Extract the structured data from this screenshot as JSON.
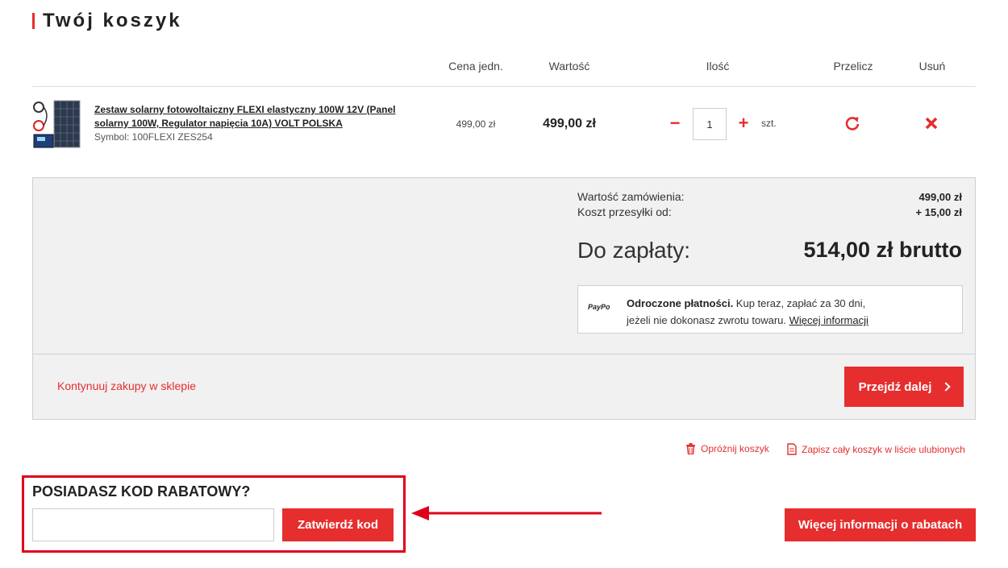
{
  "page": {
    "title": "Twój koszyk"
  },
  "table": {
    "headers": {
      "unit_price": "Cena jedn.",
      "value": "Wartość",
      "quantity": "Ilość",
      "recalc": "Przelicz",
      "remove": "Usuń"
    },
    "item": {
      "name": "Zestaw solarny fotowoltaiczny FLEXI elastyczny 100W 12V (Panel solarny 100W, Regulator napięcia 10A) VOLT POLSKA",
      "symbol": "Symbol: 100FLEXI ZES254",
      "unit_price": "499,00 zł",
      "value": "499,00 zł",
      "quantity": "1",
      "unit": "szt.",
      "minus": "−",
      "plus": "+"
    }
  },
  "summary": {
    "order_value_label": "Wartość zamówienia:",
    "order_value": "499,00 zł",
    "shipping_label": "Koszt przesyłki od:",
    "shipping_value": "+ 15,00 zł",
    "to_pay_label": "Do zapłaty:",
    "to_pay_value": "514,00 zł brutto",
    "paypo": {
      "logo": "PayPo",
      "bold": "Odroczone płatności.",
      "text1": " Kup teraz, zapłać za 30 dni,",
      "text2": "jeżeli nie dokonasz zwrotu towaru. ",
      "link": "Więcej informacji"
    },
    "continue_label": "Kontynuuj zakupy w sklepie",
    "next_label": "Przejdź dalej"
  },
  "actions": {
    "empty_cart": "Opróżnij koszyk",
    "save_favorites": "Zapisz cały koszyk w liście ulubionych"
  },
  "promo": {
    "title": "POSIADASZ KOD RABATOWY?",
    "input_value": "",
    "submit": "Zatwierdź kod",
    "more_info": "Więcej informacji o rabatach"
  },
  "colors": {
    "accent": "#e62e2e",
    "highlight": "#e0001a",
    "panel": "#f1f1f1"
  }
}
